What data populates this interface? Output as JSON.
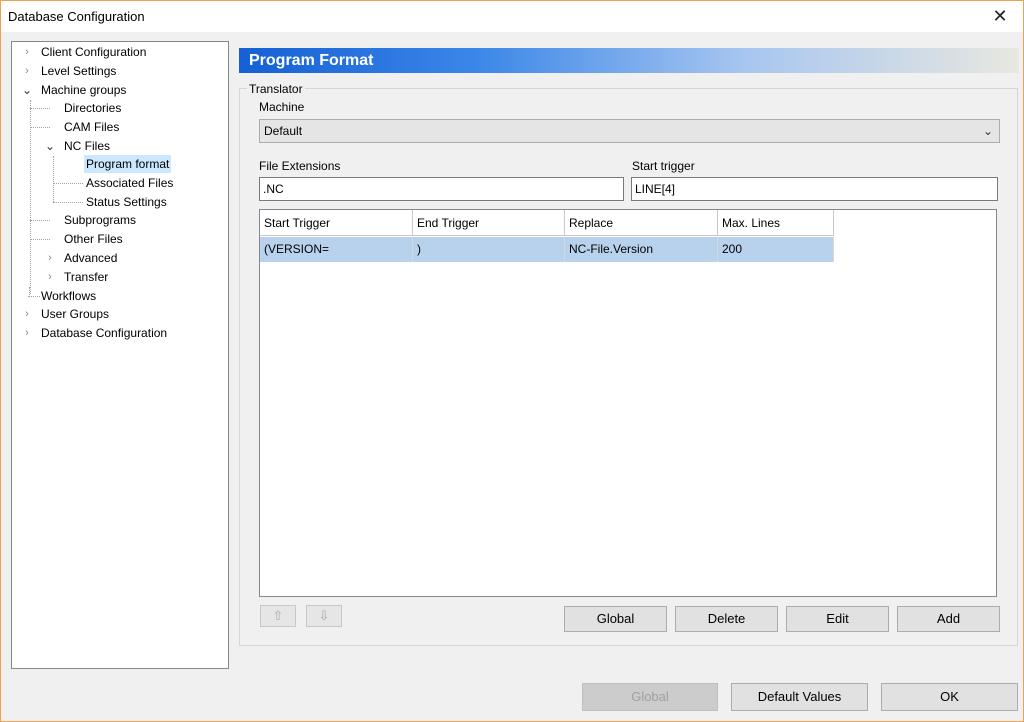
{
  "window": {
    "title": "Database Configuration"
  },
  "tree": {
    "client_configuration": "Client Configuration",
    "level_settings": "Level Settings",
    "machine_groups": "Machine groups",
    "directories": "Directories",
    "cam_files": "CAM Files",
    "nc_files": "NC Files",
    "program_format": "Program format",
    "associated_files": "Associated Files",
    "status_settings": "Status Settings",
    "subprograms": "Subprograms",
    "other_files": "Other Files",
    "advanced": "Advanced",
    "transfer": "Transfer",
    "workflows": "Workflows",
    "user_groups": "User Groups",
    "database_configuration": "Database Configuration"
  },
  "panel": {
    "header": "Program Format",
    "group_label": "Translator",
    "machine_label": "Machine",
    "machine_value": "Default",
    "file_extensions_label": "File Extensions",
    "file_extensions_value": ".NC",
    "start_trigger_label": "Start trigger",
    "start_trigger_value": "LINE[4]"
  },
  "table": {
    "columns": [
      "Start Trigger",
      "End Trigger",
      "Replace",
      "Max. Lines"
    ],
    "rows": [
      [
        "(VERSION=",
        ")",
        "NC-File.Version",
        "200"
      ]
    ]
  },
  "actions": {
    "move_up_icon": "arrow-up-icon",
    "move_down_icon": "arrow-down-icon",
    "global": "Global",
    "delete": "Delete",
    "edit": "Edit",
    "add": "Add"
  },
  "footer": {
    "global": "Global",
    "default_values": "Default Values",
    "ok": "OK"
  }
}
